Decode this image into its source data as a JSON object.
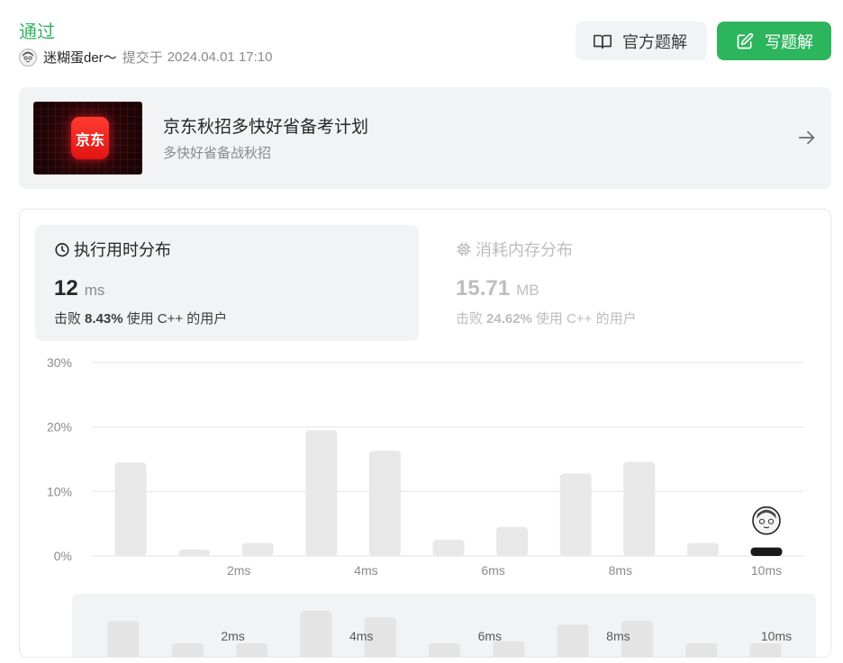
{
  "status": "通过",
  "submission": {
    "user_name": "迷糊蛋der〜",
    "submit_label": "提交于",
    "time": "2024.04.01 17:10"
  },
  "buttons": {
    "official_solution": "官方题解",
    "write_solution": "写题解"
  },
  "banner": {
    "logo_text": "京东",
    "title": "京东秋招多快好省备考计划",
    "subtitle": "多快好省备战秋招"
  },
  "runtime": {
    "title": "执行用时分布",
    "value": "12",
    "unit": "ms",
    "beat_prefix": "击败",
    "beat_pct": "8.43%",
    "beat_suffix": "使用 C++ 的用户"
  },
  "memory": {
    "title": "消耗内存分布",
    "value": "15.71",
    "unit": "MB",
    "beat_prefix": "击败",
    "beat_pct": "24.62%",
    "beat_suffix": "使用 C++ 的用户"
  },
  "colors": {
    "accent_green": "#2db55d",
    "bar": "#e8e8e8",
    "selected_bar": "#1a1a1a"
  },
  "chart_data": {
    "type": "bar",
    "y_ticks": [
      "30%",
      "20%",
      "10%",
      "0%"
    ],
    "ylim": [
      0,
      30
    ],
    "x_tick_labels": [
      "2ms",
      "4ms",
      "6ms",
      "8ms",
      "10ms"
    ],
    "x_tick_bar_index": [
      2,
      4,
      6,
      8,
      10
    ],
    "values": [
      14.5,
      1.0,
      2.0,
      19.5,
      16.3,
      2.5,
      4.5,
      12.8,
      14.6,
      2.0,
      1.3
    ],
    "selected_index": 10,
    "grid": true,
    "overview_values": [
      14.5,
      1.0,
      2.0,
      19.5,
      16.3,
      2.5,
      4.5,
      12.8,
      14.6,
      2.0,
      1.3
    ]
  }
}
